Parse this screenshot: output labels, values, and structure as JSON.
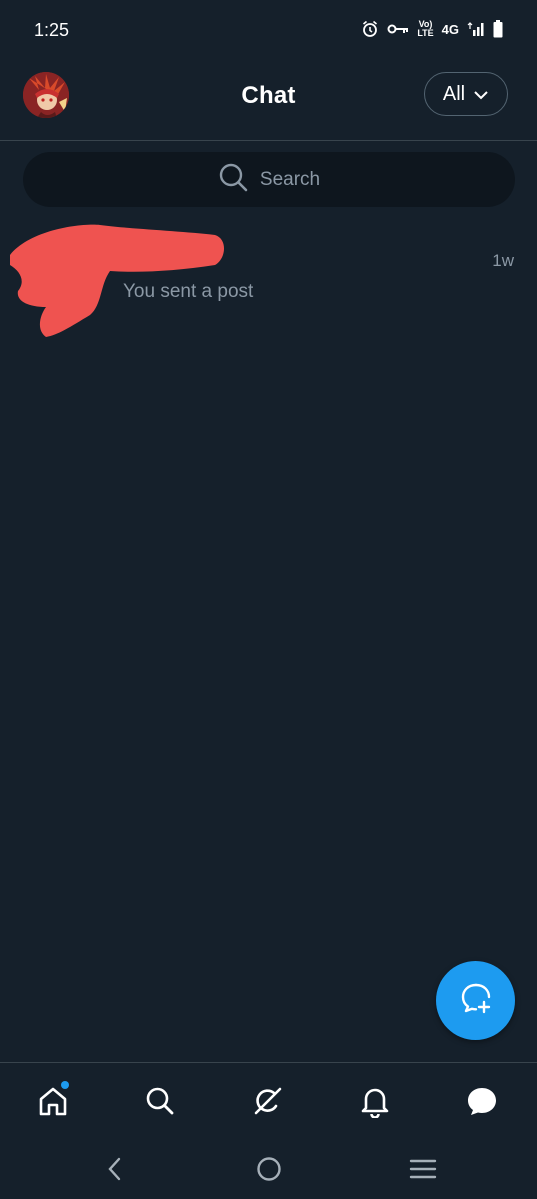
{
  "status_bar": {
    "time": "1:25",
    "volte_line1": "Vo)",
    "volte_line2": "LTE",
    "network": "4G"
  },
  "header": {
    "title": "Chat",
    "filter_label": "All"
  },
  "search": {
    "placeholder": "Search"
  },
  "conversations": [
    {
      "name_redacted": true,
      "preview": "You sent a post",
      "time": "1w"
    }
  ],
  "bottom_nav": {
    "items": [
      "home-icon",
      "search-icon",
      "grok-icon",
      "notifications-icon",
      "messages-icon"
    ],
    "home_has_notification": true
  },
  "colors": {
    "background": "#15202b",
    "accent": "#1d9bf0",
    "muted_text": "#8b98a5",
    "divider": "#38444d",
    "redaction": "#ef5350"
  }
}
